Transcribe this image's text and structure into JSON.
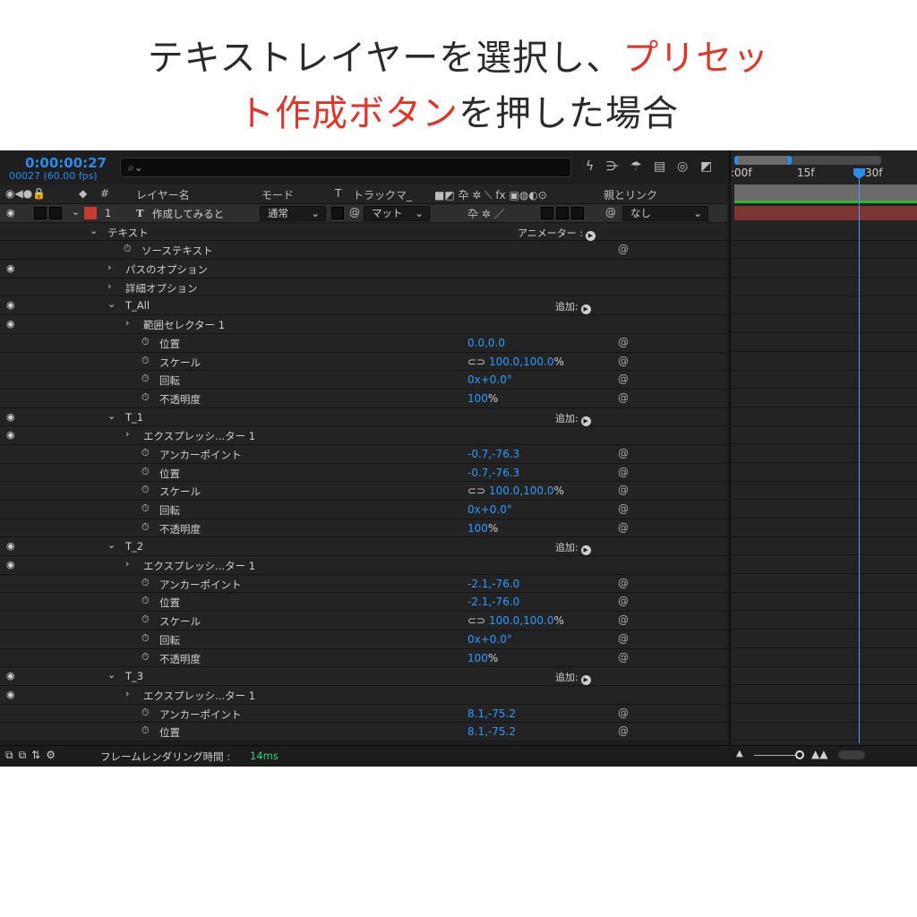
{
  "caption": {
    "line1_black": "テキストレイヤーを選択し、",
    "line1_red": "プリセッ",
    "line2_red": "ト作成ボタン",
    "line2_black": "を押した場合"
  },
  "header": {
    "timecode": "0:00:00:27",
    "frame_fps": "00027 (60.00 fps)",
    "search_placeholder": ""
  },
  "columns": {
    "layer_name": "レイヤー名",
    "mode": "モード",
    "t": "T",
    "track_matte": "トラックマ_",
    "parent_link": "親とリンク",
    "hash": "#"
  },
  "layer": {
    "number": "1",
    "type_glyph": "T",
    "name": "作成してみると",
    "mode": "通常",
    "matte": "マット",
    "parent": "なし"
  },
  "rows": [
    {
      "label": "テキスト",
      "indent": 1,
      "arrow": "down",
      "eye": false,
      "right": "アニメーター :"
    },
    {
      "label": "ソーステキスト",
      "indent": 2,
      "stopwatch": true,
      "spiral": true
    },
    {
      "label": "パスのオプション",
      "indent": 2,
      "arrow": "right",
      "eye": true
    },
    {
      "label": "詳細オプション",
      "indent": 2,
      "arrow": "right"
    },
    {
      "label": "T_All",
      "indent": 2,
      "arrow": "down",
      "eye": true,
      "add": "追加:"
    },
    {
      "label": "範囲セレクター 1",
      "indent": 3,
      "arrow": "right",
      "eye": true
    },
    {
      "label": "位置",
      "indent": 4,
      "stopwatch": true,
      "value": "0.0,0.0",
      "spiral": true
    },
    {
      "label": "スケール",
      "indent": 4,
      "stopwatch": true,
      "link": true,
      "value": "100.0,100.0",
      "unit": "%",
      "spiral": true
    },
    {
      "label": "回転",
      "indent": 4,
      "stopwatch": true,
      "value": "0x+0.0°",
      "spiral": true
    },
    {
      "label": "不透明度",
      "indent": 4,
      "stopwatch": true,
      "value": "100",
      "unit": "%",
      "spiral": true
    },
    {
      "label": "T_1",
      "indent": 2,
      "arrow": "down",
      "eye": true,
      "add": "追加:"
    },
    {
      "label": "エクスプレッシ...ター 1",
      "indent": 3,
      "arrow": "right",
      "eye": true
    },
    {
      "label": "アンカーポイント",
      "indent": 4,
      "stopwatch": true,
      "value": "-0.7,-76.3",
      "spiral": true
    },
    {
      "label": "位置",
      "indent": 4,
      "stopwatch": true,
      "value": "-0.7,-76.3",
      "spiral": true
    },
    {
      "label": "スケール",
      "indent": 4,
      "stopwatch": true,
      "link": true,
      "value": "100.0,100.0",
      "unit": "%",
      "spiral": true
    },
    {
      "label": "回転",
      "indent": 4,
      "stopwatch": true,
      "value": "0x+0.0°",
      "spiral": true
    },
    {
      "label": "不透明度",
      "indent": 4,
      "stopwatch": true,
      "value": "100",
      "unit": "%",
      "spiral": true
    },
    {
      "label": "T_2",
      "indent": 2,
      "arrow": "down",
      "eye": true,
      "add": "追加:"
    },
    {
      "label": "エクスプレッシ...ター 1",
      "indent": 3,
      "arrow": "right",
      "eye": true
    },
    {
      "label": "アンカーポイント",
      "indent": 4,
      "stopwatch": true,
      "value": "-2.1,-76.0",
      "spiral": true
    },
    {
      "label": "位置",
      "indent": 4,
      "stopwatch": true,
      "value": "-2.1,-76.0",
      "spiral": true
    },
    {
      "label": "スケール",
      "indent": 4,
      "stopwatch": true,
      "link": true,
      "value": "100.0,100.0",
      "unit": "%",
      "spiral": true
    },
    {
      "label": "回転",
      "indent": 4,
      "stopwatch": true,
      "value": "0x+0.0°",
      "spiral": true
    },
    {
      "label": "不透明度",
      "indent": 4,
      "stopwatch": true,
      "value": "100",
      "unit": "%",
      "spiral": true
    },
    {
      "label": "T_3",
      "indent": 2,
      "arrow": "down",
      "eye": true,
      "add": "追加:"
    },
    {
      "label": "エクスプレッシ...ター 1",
      "indent": 3,
      "arrow": "right",
      "eye": true
    },
    {
      "label": "アンカーポイント",
      "indent": 4,
      "stopwatch": true,
      "value": "8.1,-75.2",
      "spiral": true
    },
    {
      "label": "位置",
      "indent": 4,
      "stopwatch": true,
      "value": "8.1,-75.2",
      "spiral": true
    }
  ],
  "timeline": {
    "ticks": [
      ":00f",
      "15f",
      "30f"
    ],
    "cti_glyph": "I"
  },
  "footer": {
    "label": "フレームレンダリング時間 :",
    "value": "14ms"
  },
  "colors": {
    "accent_blue": "#2d8ceb",
    "value_blue": "#2f9bff",
    "caption_red": "#e0352b",
    "label_red": "#c73a34",
    "render_green": "#2fd38a"
  }
}
